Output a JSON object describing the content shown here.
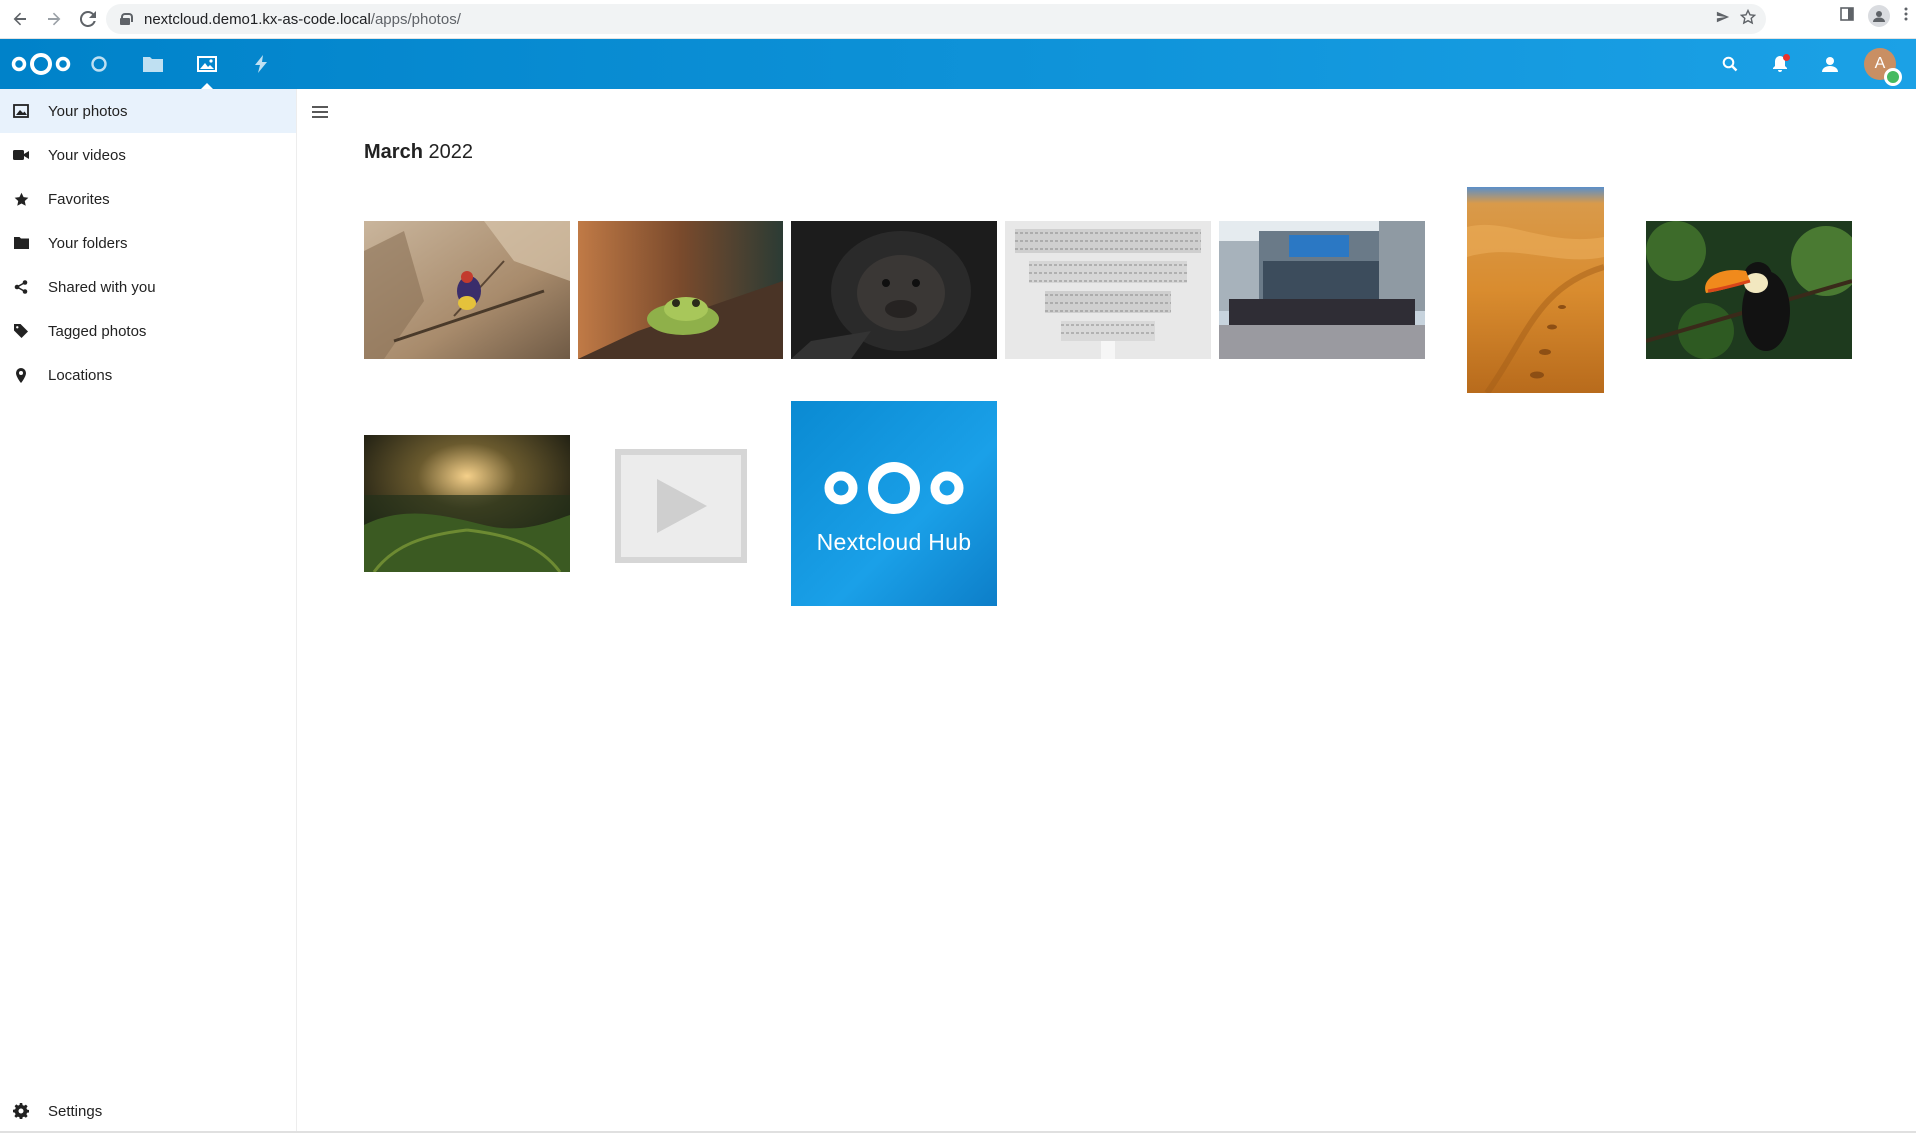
{
  "browser": {
    "url_host": "nextcloud.demo1.kx-as-code.local",
    "url_path": "/apps/photos/"
  },
  "header": {
    "apps": [
      "dashboard-icon",
      "files-icon",
      "photos-icon",
      "activity-icon"
    ],
    "active_app": "photos",
    "avatar_initial": "A"
  },
  "sidebar": {
    "items": [
      {
        "label": "Your photos",
        "icon": "image-icon",
        "active": true
      },
      {
        "label": "Your videos",
        "icon": "video-icon"
      },
      {
        "label": "Favorites",
        "icon": "star-icon"
      },
      {
        "label": "Your folders",
        "icon": "folder-icon"
      },
      {
        "label": "Shared with you",
        "icon": "share-icon"
      },
      {
        "label": "Tagged photos",
        "icon": "tag-icon"
      },
      {
        "label": "Locations",
        "icon": "location-icon"
      }
    ],
    "settings_label": "Settings"
  },
  "main": {
    "month": "March",
    "year": "2022",
    "tile_text": "Nextcloud Hub",
    "photos": [
      "bird-photo",
      "frog-photo",
      "gorilla-photo",
      "library-photo",
      "group-photo",
      "desert-photo",
      "toucan-photo",
      "vineyard-photo",
      "video-placeholder",
      "nextcloud-hub-tile"
    ]
  },
  "colors": {
    "header_start": "#0082c9",
    "header_end": "#1ba1e6",
    "active_nav": "#e8f2fc",
    "hub_tile": "#0082c9"
  }
}
